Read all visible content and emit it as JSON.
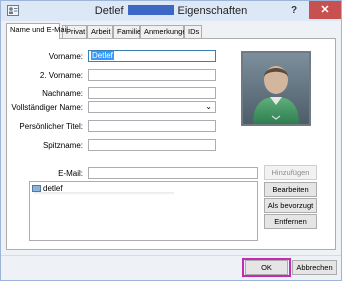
{
  "window": {
    "title_name": "Detlef",
    "title_suffix": "Eigenschaften",
    "help": "?",
    "close": "✕"
  },
  "tabs": [
    {
      "label": "Name und E-Mail",
      "active": true
    },
    {
      "label": "Privat"
    },
    {
      "label": "Arbeit"
    },
    {
      "label": "Familie"
    },
    {
      "label": "Anmerkungen"
    },
    {
      "label": "IDs"
    }
  ],
  "form": {
    "vorname_label": "Vorname:",
    "vorname_value": "Detlef",
    "zweiter_vorname_label": "2. Vorname:",
    "zweiter_vorname_value": "",
    "nachname_label": "Nachname:",
    "nachname_value": "",
    "vollstaendiger_name_label": "Vollständiger Name:",
    "vollstaendiger_name_value": "",
    "titel_label": "Persönlicher Titel:",
    "titel_value": "",
    "spitzname_label": "Spitzname:",
    "spitzname_value": "",
    "email_label": "E-Mail:",
    "email_value": ""
  },
  "buttons": {
    "hinzufuegen": "Hinzufügen",
    "bearbeiten": "Bearbeiten",
    "als_bevorzugt": "Als bevorzugt",
    "entfernen": "Entfernen",
    "ok": "OK",
    "abbrechen": "Abbrechen"
  },
  "email_list": [
    "detlef"
  ],
  "icons": {
    "contact_picture": "user-avatar-icon",
    "dropdown": "chevron-down-icon",
    "mail": "mail-icon"
  },
  "colors": {
    "title_redaction": "#3d67c4",
    "ok_highlight": "#c12bb5",
    "close_button": "#c75050"
  }
}
